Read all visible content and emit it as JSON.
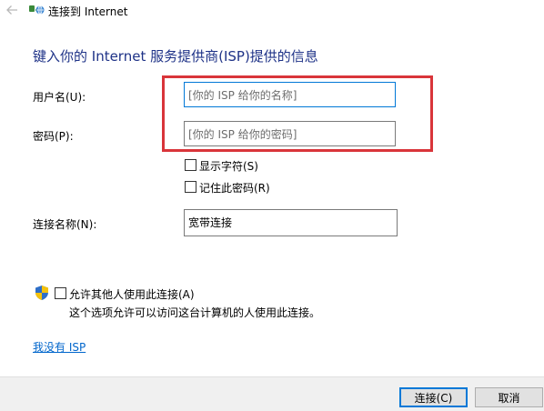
{
  "window": {
    "title": "连接到 Internet",
    "back_icon": "back-arrow-icon",
    "app_icon": "internet-connection-icon"
  },
  "heading": "键入你的 Internet 服务提供商(ISP)提供的信息",
  "form": {
    "username": {
      "label": "用户名(U):",
      "placeholder": "[你的 ISP 给你的名称]",
      "value": ""
    },
    "password": {
      "label": "密码(P):",
      "placeholder": "[你的 ISP 给你的密码]",
      "value": ""
    },
    "show_chars": {
      "label": "显示字符(S)",
      "checked": false
    },
    "remember_password": {
      "label": "记住此密码(R)",
      "checked": false
    },
    "connection_name": {
      "label": "连接名称(N):",
      "value": "宽带连接"
    }
  },
  "allow_others": {
    "label": "允许其他人使用此连接(A)",
    "checked": false,
    "description": "这个选项允许可以访问这台计算机的人使用此连接。",
    "icon": "uac-shield-icon"
  },
  "no_isp_link": "我没有 ISP",
  "buttons": {
    "connect": "连接(C)",
    "cancel": "取消"
  },
  "colors": {
    "heading": "#1e3287",
    "link": "#0066cc",
    "focus_border": "#0078d7",
    "annotation": "#d9353a",
    "footer_bg": "#f0f0f0"
  }
}
